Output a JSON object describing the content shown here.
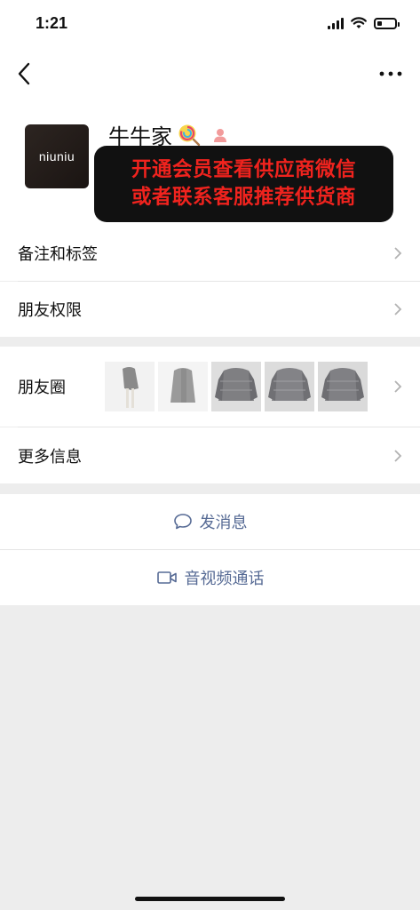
{
  "status_bar": {
    "time": "1:21",
    "battery_level": 0.25
  },
  "nav": {
    "back_icon": "chevron-left-icon",
    "more_icon": "ellipsis-icon"
  },
  "profile": {
    "avatar_text": "niuniu",
    "name": "牛牛家",
    "name_emoji": "lollipop-icon",
    "badge_icon": "person-icon",
    "promo_lines": [
      "开通会员查看供应商微信",
      "或者联系客服推荐供货商"
    ],
    "promo_color": "#f0231e"
  },
  "menu": {
    "remarks_tags": "备注和标签",
    "friend_permissions": "朋友权限",
    "moments": "朋友圈",
    "more_info": "更多信息"
  },
  "actions": {
    "send_message": "发消息",
    "video_call": "音视频通话"
  },
  "colors": {
    "link": "#576b95",
    "background": "#ededed"
  }
}
